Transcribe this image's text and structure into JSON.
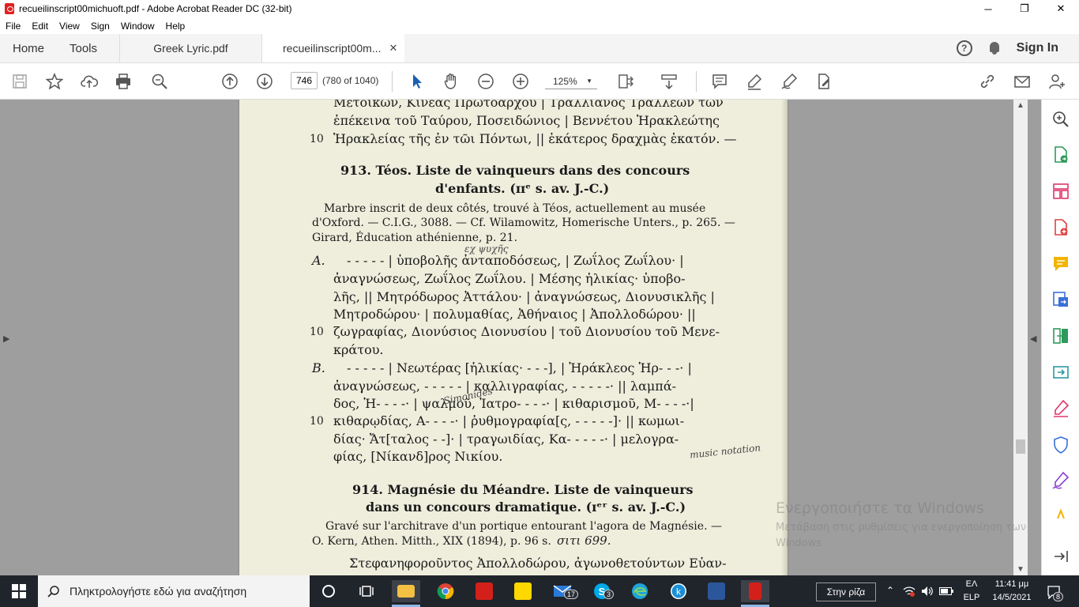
{
  "window": {
    "title": "recueilinscript00michuoft.pdf - Adobe Acrobat Reader DC (32-bit)",
    "minimize": "─",
    "maximize": "❐",
    "close": "✕"
  },
  "menu": [
    "File",
    "Edit",
    "View",
    "Sign",
    "Window",
    "Help"
  ],
  "tabs": {
    "home": "Home",
    "tools": "Tools",
    "doc1": "Greek Lyric.pdf",
    "doc2": "recueilinscript00m...",
    "doc2_close": "✕"
  },
  "header": {
    "help": "?",
    "sign_in": "Sign In"
  },
  "toolbar": {
    "page_current": "746",
    "page_count": "(780 of 1040)",
    "zoom": "125%",
    "zoom_arrow": "▼"
  },
  "document": {
    "lines": [
      "Μετοίκων, Κινέας Πρωτοάρχου | Τραλλιανὸς Τραλλέων τῶν",
      "ἐπέκεινα τοῦ Ταύρου, Ποσειδώνιος | Βεννέτου Ἡρακλεώτης",
      "Ἡρακλείας τῆς ἐν τῶι Πόντωι, || ἑκάτερος δραχμὰς ἑκατόν. —"
    ],
    "line10a": "10",
    "h913_1": "913. Téos. Liste de vainqueurs dans des concours",
    "h913_2": "d'enfants. (ɪɪᵉ s. av. J.-C.)",
    "desc913": [
      "Marbre inscrit de deux côtés, trouvé à Téos, actuellement au musée",
      "d'Oxford. — C.I.G., 3088. — Cf. Wilamowitz, Homerische Unters., p. 265. —",
      "Girard, Éducation athénienne, p. 21."
    ],
    "labelA": "A.",
    "textA": [
      "- - - - - | ὑποβολῆς ἀνταποδόσεως, | Ζωΐλος Ζωΐλου· |",
      "ἀναγνώσεως, Ζωΐλος Ζωΐλου. | Μέσης ἡλικίας· ὑποβο-",
      "λῆς, || Μητρόδωρος Ἀττάλου· | ἀναγνώσεως, Διονυσικλῆς |",
      "Μητροδώρου· | πολυμαθίας, Ἀθήναιος | Ἀπολλοδώρου· ||",
      "ζωγραφίας, Διονύσιος Διονυσίου | τοῦ Διονυσίου τοῦ Μενε-",
      "κράτου."
    ],
    "line10b": "10",
    "labelB": "B.",
    "textB": [
      "- - - - - | Νεωτέρας [ἡλικίας· - - -], | Ἡράκλεος Ἡρ- - -· |",
      "ἀναγνώσεως, - - - - - | καλλιγραφίας, - - - - -· || λαμπά-",
      "δος, Ἡ- - - -· | ψαλμοῦ, Ἰατρο- - - -· | κιθαρισμοῦ, Μ- - - -·|",
      "κιθαρῳδίας, Α- - - -· | ῥυθμογραφία[ς, - - - - -]· || κωμωι-",
      "δίας· Ἄτ[ταλος - -]· | τραγωιδίας, Κα- - - - -· | μελογρα-",
      "φίας, [Νίκανδ]ρος Νικίου."
    ],
    "line10c": "10",
    "h914_1": "914. Magnésie du Méandre. Liste de vainqueurs",
    "h914_2": "dans un concours dramatique. (ɪᵉʳ s. av. J.-C.)",
    "desc914": [
      "Gravé sur l'architrave d'un portique entourant l'agora de Magnésie. —",
      "O. Kern, Athen. Mitth., XIX (1894), p. 96 s."
    ],
    "handnote_914": "σιτι 699.",
    "last_line": "Στεφανηφοροῦντος Ἀπολλοδώρου, ἀγωνοθετούντων Εὐαν-",
    "margin_note1": "εχ ψυχῆς",
    "margin_note2": "music notation",
    "margin_note3": "Simonides"
  },
  "watermark": {
    "line1": "Ενεργοποιήστε τα Windows",
    "line2": "Μετάβαση στις ρυθμίσεις για ενεργοποίηση των Windows"
  },
  "taskbar": {
    "search_placeholder": "Πληκτρολογήστε εδώ για αναζήτηση",
    "field_text": "Στην ρίζα",
    "lang1": "ΕΛ",
    "lang2": "ELP",
    "time": "11:41 μμ",
    "date": "14/5/2021",
    "mail_badge": "17",
    "notif_badge": "8"
  }
}
